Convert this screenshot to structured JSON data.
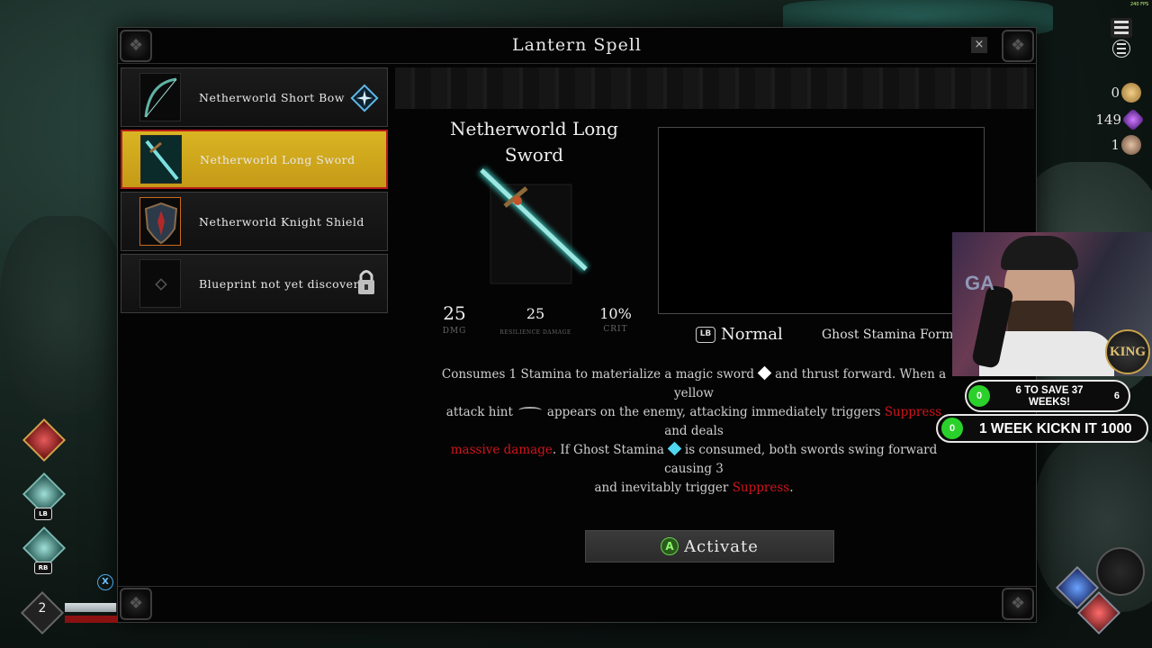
{
  "dialog": {
    "title": "Lantern Spell",
    "close_icon": "×"
  },
  "blueprints": [
    {
      "label": "Netherworld Short Bow",
      "selected": false,
      "icon": "bow-icon"
    },
    {
      "label": "Netherworld Long Sword",
      "selected": true,
      "icon": "sword-icon"
    },
    {
      "label": "Netherworld Knight Shield",
      "selected": false,
      "icon": "shield-icon"
    },
    {
      "label": "Blueprint not yet discovered",
      "selected": false,
      "icon": "lock-icon"
    }
  ],
  "detail": {
    "name": "Netherworld Long Sword",
    "stats": [
      {
        "value": "25",
        "label": "DMG"
      },
      {
        "value": "25",
        "label": "RESILIENCE DAMAGE"
      },
      {
        "value": "10%",
        "label": "CRIT"
      }
    ],
    "mode_button": "LB",
    "mode_label": "Normal",
    "ghost_label": "Ghost Stamina Form",
    "description": {
      "p1": "Consumes 1 Stamina to materialize a magic sword",
      "p2": "and thrust forward. When a yellow",
      "p3": "attack hint",
      "p4": "appears on the enemy, attacking immediately triggers",
      "kw1": "Suppress",
      "p5": "and deals",
      "kw2": "massive damage",
      "p6": ". If Ghost Stamina",
      "p7": "is consumed, both swords swing forward causing 3",
      "p8": "and inevitably trigger",
      "kw3": "Suppress",
      "p9": "."
    },
    "activate_button": "A",
    "activate_label": "Activate"
  },
  "hud": {
    "fps": "240 FPS",
    "currencies": [
      {
        "value": "0",
        "icon": "coin-icon",
        "color": "#c9a15a"
      },
      {
        "value": "149",
        "icon": "gem-icon",
        "color": "#8a3fc7"
      },
      {
        "value": "1",
        "icon": "skull-token-icon",
        "color": "#b88c6a"
      }
    ],
    "level": "2",
    "x_button": "X",
    "skill_tags": [
      "LB",
      "RB"
    ],
    "hp_fraction": 0.98,
    "stamina_fraction": 1.0
  },
  "stream": {
    "badge": "KING",
    "webcam_text": "GA",
    "goal1": {
      "count_left": "0",
      "text": "6 TO SAVE 37 WEEKS!",
      "count_right": "6"
    },
    "goal2": {
      "count_left": "0",
      "text": "1 WEEK KICKN IT 1000"
    }
  },
  "colors": {
    "selected_bg": "#d1a81f",
    "selected_border": "#b91b1b",
    "keyword": "#d0141b",
    "goal_green": "#2bd12b"
  }
}
